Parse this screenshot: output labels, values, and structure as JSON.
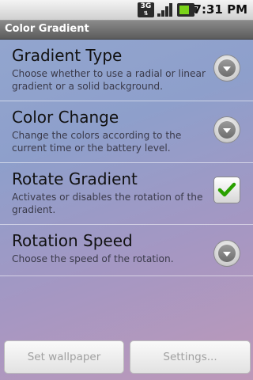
{
  "status_bar": {
    "network_label": "3G",
    "clock": "7:31 PM",
    "icons": [
      "3g-icon",
      "signal-icon",
      "battery-icon"
    ]
  },
  "app": {
    "title": "Color Gradient"
  },
  "preferences": [
    {
      "title": "Gradient Type",
      "summary": "Choose whether to use a radial or linear gradient or a solid background.",
      "widget": "dropdown"
    },
    {
      "title": "Color Change",
      "summary": "Change the colors according to the current time or the battery level.",
      "widget": "dropdown"
    },
    {
      "title": "Rotate Gradient",
      "summary": "Activates or disables the rotation of the gradient.",
      "widget": "checkbox",
      "checked": true
    },
    {
      "title": "Rotation Speed",
      "summary": "Choose the speed of the rotation.",
      "widget": "dropdown"
    }
  ],
  "buttons": {
    "set_wallpaper": "Set wallpaper",
    "settings": "Settings..."
  },
  "colors": {
    "check": "#29a000",
    "battery_level": "#7ad319"
  }
}
